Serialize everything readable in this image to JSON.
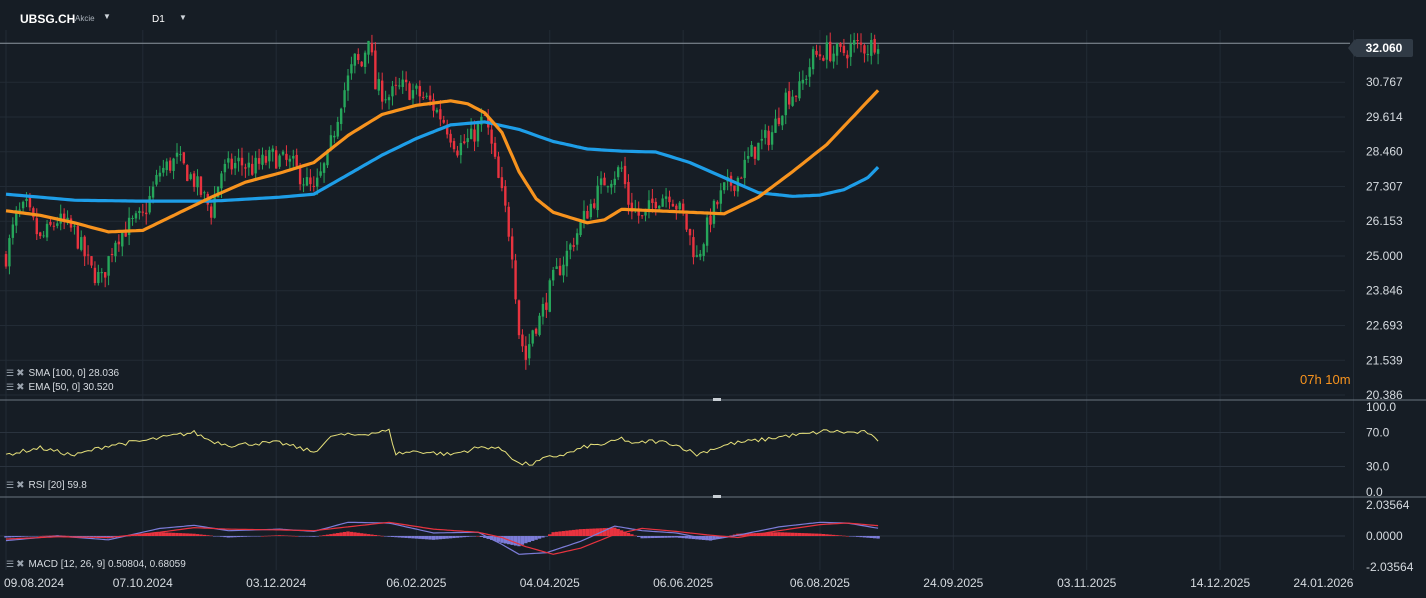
{
  "header": {
    "symbol": "UBSG.CH",
    "symbol_type": "Akcie",
    "timeframe": "D1",
    "countdown": "07h 10m"
  },
  "colors": {
    "background": "#161d25",
    "up": "#26a65b",
    "down": "#e8333f",
    "sma": "#1e9ee8",
    "ema": "#f7931e",
    "rsi": "#e6e07a",
    "macd_line": "#7c7cd8",
    "signal_line": "#e8333f",
    "hist_pos": "#e8333f",
    "hist_neg": "#7c7cd8"
  },
  "legends": {
    "sma": "SMA [100, 0] 28.036",
    "ema": "EMA [50, 0] 30.520",
    "rsi": "RSI [20] 59.8",
    "macd": "MACD [12, 26, 9] 0.50804, 0.68059"
  },
  "chart_data": [
    {
      "type": "candlestick",
      "panel": "price",
      "current_price": "32.060",
      "y_ticks": [
        "32.060",
        "30.767",
        "29.614",
        "28.460",
        "27.307",
        "26.153",
        "25.000",
        "23.846",
        "22.693",
        "21.539",
        "20.386"
      ],
      "ylim": [
        20.386,
        32.5
      ],
      "x_ticks": [
        "09.08.2024",
        "07.10.2024",
        "03.12.2024",
        "06.02.2025",
        "04.04.2025",
        "06.06.2025",
        "06.08.2025",
        "24.09.2025",
        "03.11.2025",
        "14.12.2025",
        "24.01.2026"
      ],
      "close_path": [
        [
          0,
          25.0
        ],
        [
          3,
          26.3
        ],
        [
          6,
          26.6
        ],
        [
          10,
          25.5
        ],
        [
          15,
          26.2
        ],
        [
          20,
          25.8
        ],
        [
          25,
          24.5
        ],
        [
          28,
          24.2
        ],
        [
          32,
          25.6
        ],
        [
          36,
          26.0
        ],
        [
          40,
          26.3
        ],
        [
          45,
          27.8
        ],
        [
          50,
          28.2
        ],
        [
          55,
          27.5
        ],
        [
          60,
          26.5
        ],
        [
          63,
          27.8
        ],
        [
          68,
          28.1
        ],
        [
          72,
          27.9
        ],
        [
          78,
          28.3
        ],
        [
          84,
          28.0
        ],
        [
          90,
          27.1
        ],
        [
          94,
          28.2
        ],
        [
          98,
          30.2
        ],
        [
          102,
          31.5
        ],
        [
          104,
          31.3
        ],
        [
          106,
          32.4
        ],
        [
          108,
          30.6
        ],
        [
          112,
          30.3
        ],
        [
          116,
          30.6
        ],
        [
          120,
          30.4
        ],
        [
          124,
          30.1
        ],
        [
          128,
          29.5
        ],
        [
          132,
          28.6
        ],
        [
          136,
          28.9
        ],
        [
          140,
          29.6
        ],
        [
          142,
          28.6
        ],
        [
          144,
          27.5
        ],
        [
          146,
          26.5
        ],
        [
          148,
          25.2
        ],
        [
          150,
          22.5
        ],
        [
          152,
          21.6
        ],
        [
          154,
          22.6
        ],
        [
          156,
          22.9
        ],
        [
          160,
          24.2
        ],
        [
          165,
          25.3
        ],
        [
          170,
          26.5
        ],
        [
          175,
          27.5
        ],
        [
          180,
          27.9
        ],
        [
          182,
          26.8
        ],
        [
          186,
          26.2
        ],
        [
          190,
          26.9
        ],
        [
          194,
          27.1
        ],
        [
          198,
          26.3
        ],
        [
          202,
          24.9
        ],
        [
          206,
          26.3
        ],
        [
          210,
          27.2
        ],
        [
          214,
          27.6
        ],
        [
          218,
          28.4
        ],
        [
          224,
          29.1
        ],
        [
          228,
          30.3
        ],
        [
          232,
          30.5
        ],
        [
          236,
          31.6
        ],
        [
          240,
          31.8
        ],
        [
          244,
          31.7
        ],
        [
          248,
          32.0
        ],
        [
          252,
          31.9
        ],
        [
          255,
          32.2
        ]
      ],
      "series": [
        {
          "name": "SMA [100, 0]",
          "points": [
            [
              0,
              27.05
            ],
            [
              20,
              26.85
            ],
            [
              40,
              26.82
            ],
            [
              60,
              26.82
            ],
            [
              80,
              26.95
            ],
            [
              90,
              27.05
            ],
            [
              100,
              27.7
            ],
            [
              110,
              28.35
            ],
            [
              120,
              28.9
            ],
            [
              130,
              29.35
            ],
            [
              140,
              29.45
            ],
            [
              150,
              29.2
            ],
            [
              160,
              28.8
            ],
            [
              170,
              28.55
            ],
            [
              180,
              28.48
            ],
            [
              190,
              28.45
            ],
            [
              200,
              28.1
            ],
            [
              210,
              27.6
            ],
            [
              220,
              27.1
            ],
            [
              230,
              26.98
            ],
            [
              238,
              27.02
            ],
            [
              245,
              27.2
            ],
            [
              252,
              27.6
            ],
            [
              255,
              27.95
            ]
          ]
        },
        {
          "name": "EMA [50, 0]",
          "points": [
            [
              0,
              26.5
            ],
            [
              10,
              26.35
            ],
            [
              20,
              26.1
            ],
            [
              30,
              25.8
            ],
            [
              40,
              25.85
            ],
            [
              50,
              26.4
            ],
            [
              60,
              26.95
            ],
            [
              70,
              27.45
            ],
            [
              80,
              27.75
            ],
            [
              90,
              28.1
            ],
            [
              100,
              29.0
            ],
            [
              110,
              29.7
            ],
            [
              120,
              30.0
            ],
            [
              130,
              30.15
            ],
            [
              135,
              30.05
            ],
            [
              140,
              29.75
            ],
            [
              145,
              29.1
            ],
            [
              150,
              27.8
            ],
            [
              155,
              26.9
            ],
            [
              160,
              26.45
            ],
            [
              170,
              26.1
            ],
            [
              175,
              26.2
            ],
            [
              180,
              26.55
            ],
            [
              190,
              26.5
            ],
            [
              200,
              26.45
            ],
            [
              210,
              26.4
            ],
            [
              220,
              26.95
            ],
            [
              230,
              27.8
            ],
            [
              240,
              28.7
            ],
            [
              250,
              29.9
            ],
            [
              255,
              30.5
            ]
          ]
        }
      ]
    },
    {
      "type": "line",
      "panel": "rsi",
      "y_ticks": [
        "100.0",
        "70.0",
        "30.0",
        "0.0"
      ],
      "ylim": [
        0,
        100
      ],
      "series": [
        {
          "name": "RSI [20]",
          "points": [
            [
              0,
              44
            ],
            [
              10,
              52
            ],
            [
              20,
              43
            ],
            [
              30,
              55
            ],
            [
              40,
              60
            ],
            [
              50,
              67
            ],
            [
              55,
              70
            ],
            [
              60,
              60
            ],
            [
              66,
              55
            ],
            [
              72,
              57
            ],
            [
              80,
              58
            ],
            [
              90,
              47
            ],
            [
              96,
              67
            ],
            [
              102,
              67
            ],
            [
              108,
              70
            ],
            [
              112,
              72
            ],
            [
              114,
              45
            ],
            [
              120,
              48
            ],
            [
              130,
              44
            ],
            [
              138,
              52
            ],
            [
              142,
              53
            ],
            [
              146,
              48
            ],
            [
              150,
              33
            ],
            [
              154,
              33
            ],
            [
              158,
              40
            ],
            [
              164,
              45
            ],
            [
              170,
              54
            ],
            [
              176,
              57
            ],
            [
              180,
              63
            ],
            [
              184,
              56
            ],
            [
              188,
              60
            ],
            [
              194,
              58
            ],
            [
              198,
              52
            ],
            [
              202,
              44
            ],
            [
              206,
              50
            ],
            [
              212,
              57
            ],
            [
              218,
              60
            ],
            [
              222,
              62
            ],
            [
              228,
              66
            ],
            [
              234,
              68
            ],
            [
              240,
              72
            ],
            [
              246,
              70
            ],
            [
              252,
              70
            ],
            [
              255,
              58
            ]
          ]
        }
      ]
    },
    {
      "type": "bar+line",
      "panel": "macd",
      "y_ticks": [
        "2.03564",
        "0.0000",
        "-2.03564"
      ],
      "ylim": [
        -2.03564,
        2.03564
      ],
      "series": [
        {
          "name": "macd",
          "points": [
            [
              0,
              -0.3
            ],
            [
              15,
              0.0
            ],
            [
              30,
              -0.25
            ],
            [
              45,
              0.5
            ],
            [
              55,
              0.7
            ],
            [
              65,
              0.35
            ],
            [
              80,
              0.45
            ],
            [
              90,
              0.3
            ],
            [
              100,
              0.9
            ],
            [
              112,
              0.85
            ],
            [
              125,
              0.2
            ],
            [
              138,
              0.25
            ],
            [
              145,
              -0.55
            ],
            [
              150,
              -1.2
            ],
            [
              158,
              -1.1
            ],
            [
              168,
              -0.35
            ],
            [
              178,
              0.65
            ],
            [
              186,
              0.35
            ],
            [
              196,
              0.2
            ],
            [
              206,
              -0.25
            ],
            [
              214,
              0.05
            ],
            [
              226,
              0.6
            ],
            [
              238,
              0.9
            ],
            [
              246,
              0.85
            ],
            [
              255,
              0.51
            ]
          ]
        },
        {
          "name": "signal",
          "points": [
            [
              0,
              -0.2
            ],
            [
              15,
              -0.05
            ],
            [
              30,
              -0.1
            ],
            [
              45,
              0.25
            ],
            [
              55,
              0.55
            ],
            [
              65,
              0.45
            ],
            [
              80,
              0.4
            ],
            [
              90,
              0.35
            ],
            [
              100,
              0.6
            ],
            [
              112,
              0.9
            ],
            [
              125,
              0.45
            ],
            [
              138,
              0.25
            ],
            [
              145,
              -0.1
            ],
            [
              152,
              -0.7
            ],
            [
              160,
              -1.2
            ],
            [
              168,
              -0.8
            ],
            [
              178,
              0.1
            ],
            [
              186,
              0.5
            ],
            [
              196,
              0.3
            ],
            [
              206,
              0.05
            ],
            [
              214,
              -0.1
            ],
            [
              226,
              0.35
            ],
            [
              238,
              0.75
            ],
            [
              246,
              0.85
            ],
            [
              255,
              0.68
            ]
          ]
        }
      ]
    }
  ]
}
